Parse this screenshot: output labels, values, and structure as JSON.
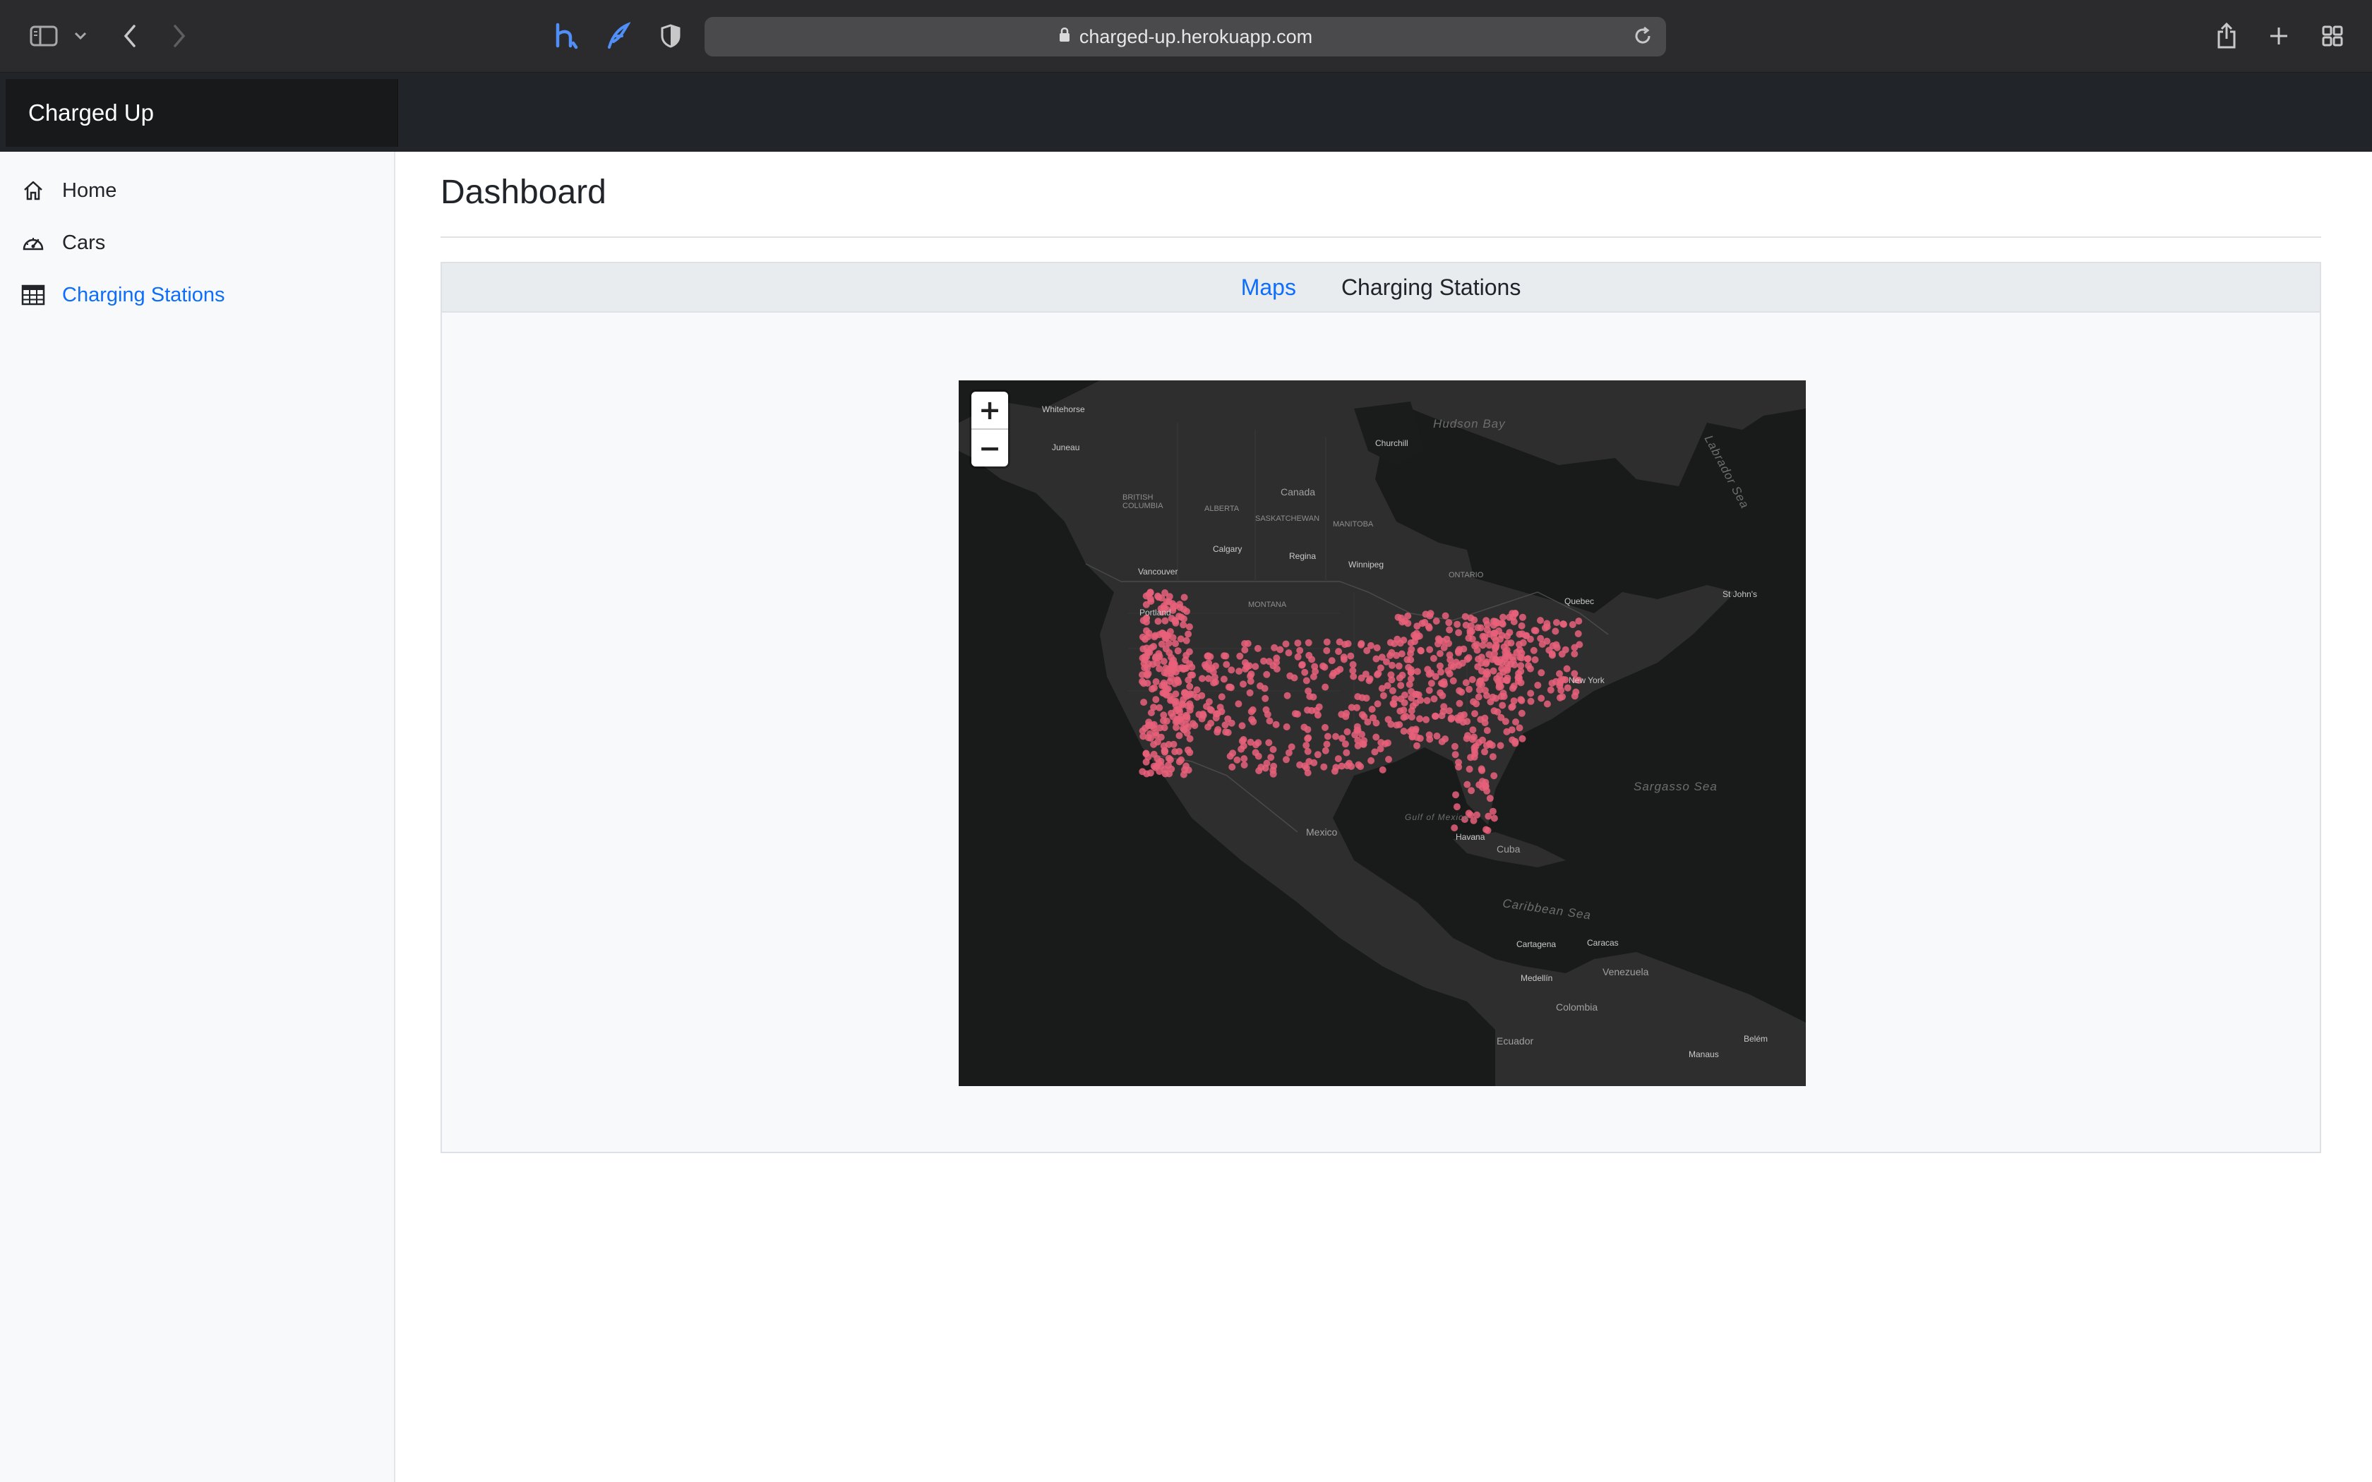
{
  "browser": {
    "url": "charged-up.herokuapp.com",
    "icons": [
      "sidebar-toggle-icon",
      "chevron-down-icon",
      "back-icon",
      "forward-icon",
      "heroku-extension-icon",
      "feather-extension-icon",
      "shield-icon",
      "lock-icon",
      "reload-icon",
      "share-icon",
      "new-tab-icon",
      "tab-overview-icon"
    ]
  },
  "navbar": {
    "brand": "Charged Up"
  },
  "sidebar": {
    "items": [
      {
        "label": "Home",
        "icon": "home-icon"
      },
      {
        "label": "Cars",
        "icon": "speedometer-icon"
      },
      {
        "label": "Charging Stations",
        "icon": "table-icon",
        "active": true
      }
    ]
  },
  "main": {
    "title": "Dashboard",
    "tabs": [
      {
        "label": "Maps",
        "active": true
      },
      {
        "label": "Charging Stations",
        "active": false
      }
    ]
  },
  "map": {
    "zoom_in": "+",
    "zoom_out": "−",
    "marker_color": "#e8607a",
    "labels": {
      "hudson_bay": "Hudson Bay",
      "labrador_sea": "Labrador Sea",
      "sargasso_sea": "Sargasso Sea",
      "caribbean_sea": "Caribbean Sea",
      "gulf_of_mexico": "Gulf of Mexico",
      "canada": "Canada",
      "mexico": "Mexico",
      "cuba": "Cuba",
      "colombia": "Colombia",
      "venezuela": "Venezuela",
      "ecuador": "Ecuador",
      "new_york": "New York",
      "vancouver": "Vancouver",
      "calgary": "Calgary",
      "regina": "Regina",
      "winnipeg": "Winnipeg",
      "churchill": "Churchill",
      "whitehorse": "Whitehorse",
      "juneau": "Juneau",
      "quebec": "Quebec",
      "st_johns": "St John's",
      "havana": "Havana",
      "caracas": "Caracas",
      "cartagena": "Cartagena",
      "medellin": "Medellín",
      "belem": "Belém",
      "manaus": "Manaus",
      "portland": "Portland",
      "ontario": "ONTARIO",
      "montana": "MONTANA",
      "alberta": "ALBERTA",
      "british_columbia": "BRITISH COLUMBIA",
      "saskatchewan": "SASKATCHEWAN",
      "manitoba": "MANITOBA"
    }
  }
}
